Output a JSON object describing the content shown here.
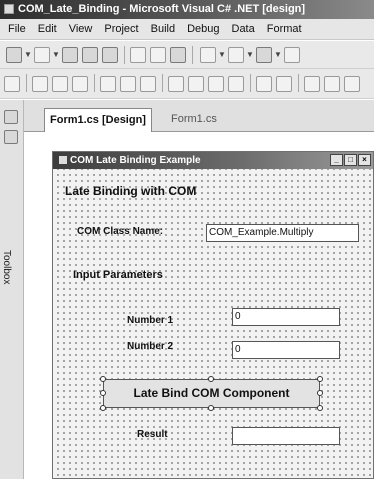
{
  "window": {
    "title": "COM_Late_Binding - Microsoft Visual C# .NET [design]"
  },
  "menu": [
    "File",
    "Edit",
    "View",
    "Project",
    "Build",
    "Debug",
    "Data",
    "Format"
  ],
  "toolbox": {
    "label": "Toolbox"
  },
  "doc_tabs": [
    {
      "label": "Form1.cs [Design]",
      "active": true
    },
    {
      "label": "Form1.cs",
      "active": false
    }
  ],
  "form": {
    "title": "COM Late Binding Example",
    "heading": "Late Binding with COM",
    "class_name_label": "COM Class Name:",
    "class_name_value": "COM_Example.Multiply",
    "input_params_label": "Input Parameters",
    "number1_label": "Number 1",
    "number1_value": "0",
    "number2_label": "Number 2",
    "number2_value": "0",
    "button_label": "Late Bind COM Component",
    "result_label": "Result",
    "result_value": ""
  }
}
